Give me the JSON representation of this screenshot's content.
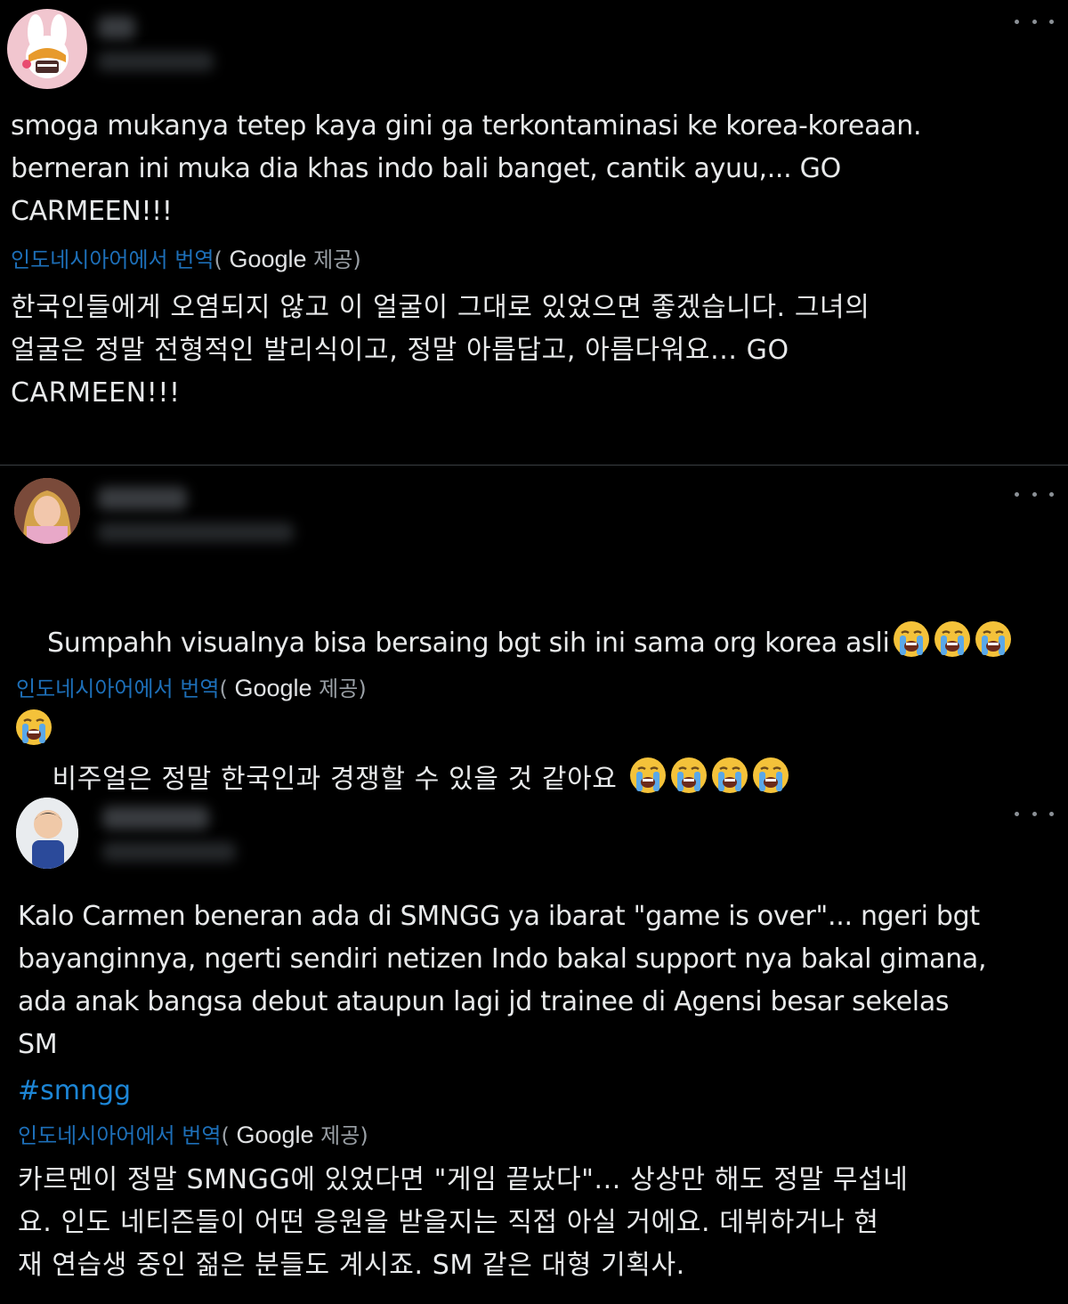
{
  "colors": {
    "background": "#000000",
    "text": "#e7e9ea",
    "translate_link": "#1d6fb8",
    "hashtag": "#1d86d6",
    "muted": "#9aa0a6"
  },
  "icons": {
    "more": "more-options-icon",
    "emoji": "loudly-crying-face-emoji"
  },
  "tweets": [
    {
      "text": "smoga mukanya tetep kaya gini ga terkontaminasi ke korea-koreaan.\nberneran ini muka dia khas indo bali banget, cantik ayuu,... GO\nCARMEEN!!!",
      "translate_link": "인도네시아어에서 번역",
      "translate_open": "(",
      "translate_provider": "Google",
      "translate_close": " 제공)",
      "translation": "한국인들에게 오염되지 않고 이 얼굴이 그대로 있었으면 좋겠습니다. 그녀의\n얼굴은 정말 전형적인 발리식이고, 정말 아름답고, 아름다워요... GO\nCARMEEN!!!"
    },
    {
      "text_line1": "Sumpahh visualnya bisa bersaing bgt sih ini sama org korea asli",
      "translate_link": "인도네시아어에서 번역",
      "translate_open": "(",
      "translate_provider": "Google",
      "translate_close": " 제공)",
      "translation": "비주얼은 정말 한국인과 경쟁할 수 있을 것 같아요"
    },
    {
      "text": "Kalo Carmen beneran ada di SMNGG ya ibarat \"game is over\"... ngeri bgt\nbayanginnya, ngerti sendiri netizen Indo bakal support nya bakal gimana,\nada anak bangsa debut ataupun lagi jd trainee di Agensi besar sekelas\nSM",
      "hashtag": "#smngg",
      "translate_link": "인도네시아어에서 번역",
      "translate_open": "(",
      "translate_provider": "Google",
      "translate_close": " 제공)",
      "translation": "카르멘이 정말 SMNGG에 있었다면 \"게임 끝났다\"... 상상만 해도 정말 무섭네\n요. 인도 네티즌들이 어떤 응원을 받을지는 직접 아실 거에요. 데뷔하거나 현\n재 연습생 중인 젊은 분들도 계시죠. SM 같은 대형 기획사."
    }
  ]
}
